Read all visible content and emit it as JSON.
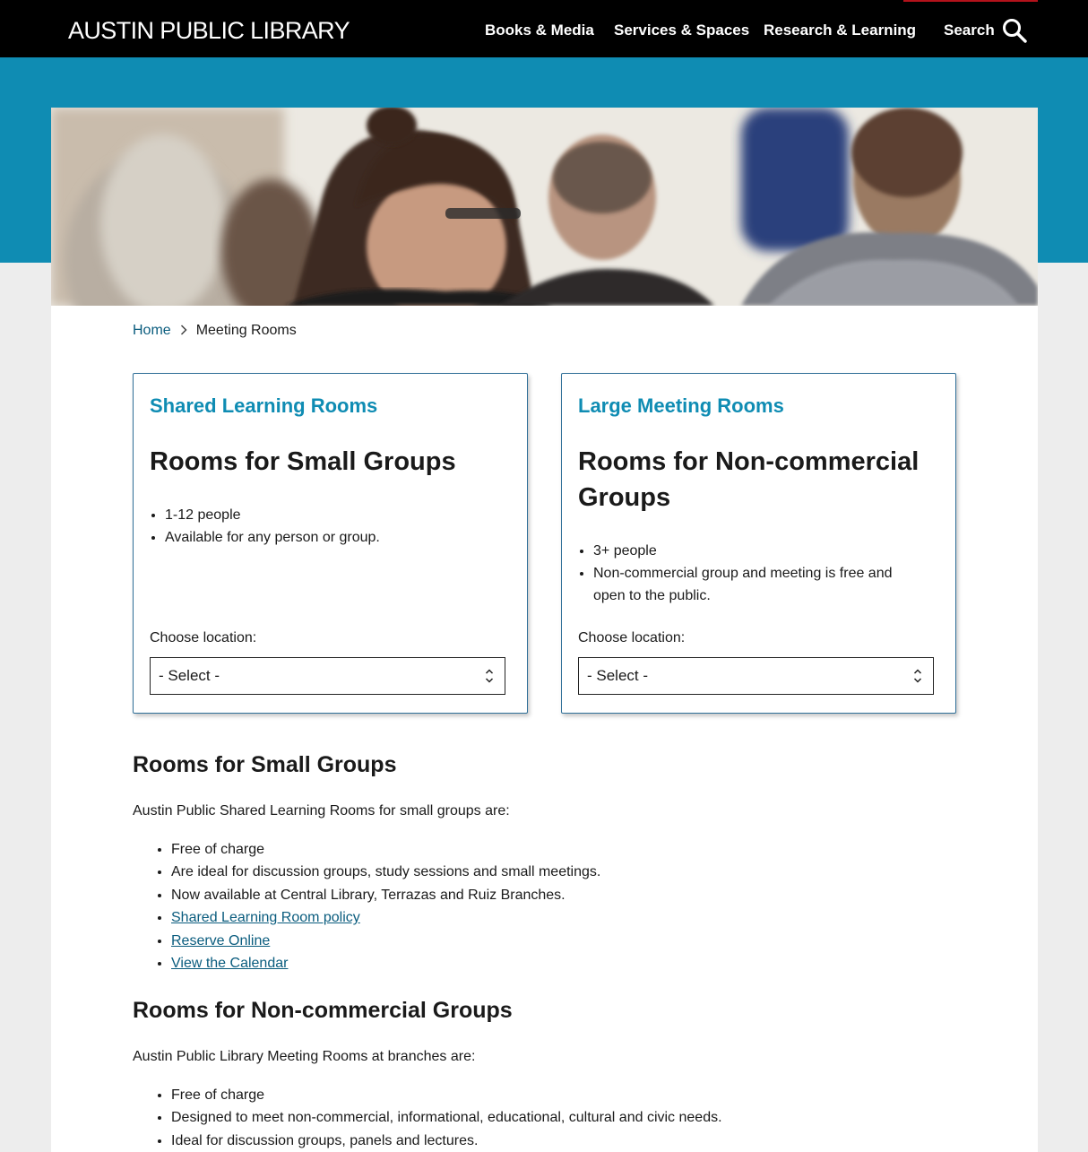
{
  "header": {
    "logo_text": "AUSTIN PUBLIC LIBRARY",
    "nav": [
      "Books & Media",
      "Services & Spaces",
      "Research & Learning"
    ],
    "search_label": "Search"
  },
  "breadcrumb": {
    "home": "Home",
    "current": "Meeting Rooms"
  },
  "cards": [
    {
      "eyebrow": "Shared Learning Rooms",
      "title": "Rooms for Small Groups",
      "items": [
        "1-12 people",
        "Available for any person or group."
      ],
      "choose_label": "Choose location:",
      "select_value": "- Select -"
    },
    {
      "eyebrow": "Large Meeting Rooms",
      "title": "Rooms for Non-commercial Groups",
      "items": [
        "3+ people",
        "Non-commercial group and meeting is free and open to the public."
      ],
      "choose_label": "Choose location:",
      "select_value": "- Select -"
    }
  ],
  "small_section": {
    "heading": "Rooms for Small Groups",
    "intro": "Austin Public Shared Learning Rooms for small groups are:",
    "items": [
      "Free of charge",
      "Are ideal for discussion groups, study sessions and small meetings.",
      "Now available at Central Library, Terrazas and Ruiz Branches."
    ],
    "links": [
      "Shared Learning Room policy",
      "Reserve Online",
      "View the Calendar"
    ]
  },
  "noncommercial_section": {
    "heading": "Rooms for Non-commercial Groups",
    "intro": "Austin Public Library Meeting Rooms at branches are:",
    "items": [
      "Free of charge",
      "Designed to meet non-commercial, informational, educational, cultural and civic needs.",
      "Ideal for discussion groups, panels and lectures."
    ]
  },
  "colors": {
    "header_bg": "#000000",
    "teal_band": "#0f8cb3",
    "eyebrow": "#0f8cb3",
    "link": "#0a5c7e",
    "card_border": "#2f6f98"
  },
  "icons": {
    "search": "search-icon",
    "breadcrumb_separator": "chevron-right-icon",
    "select": "select-arrows-icon"
  }
}
